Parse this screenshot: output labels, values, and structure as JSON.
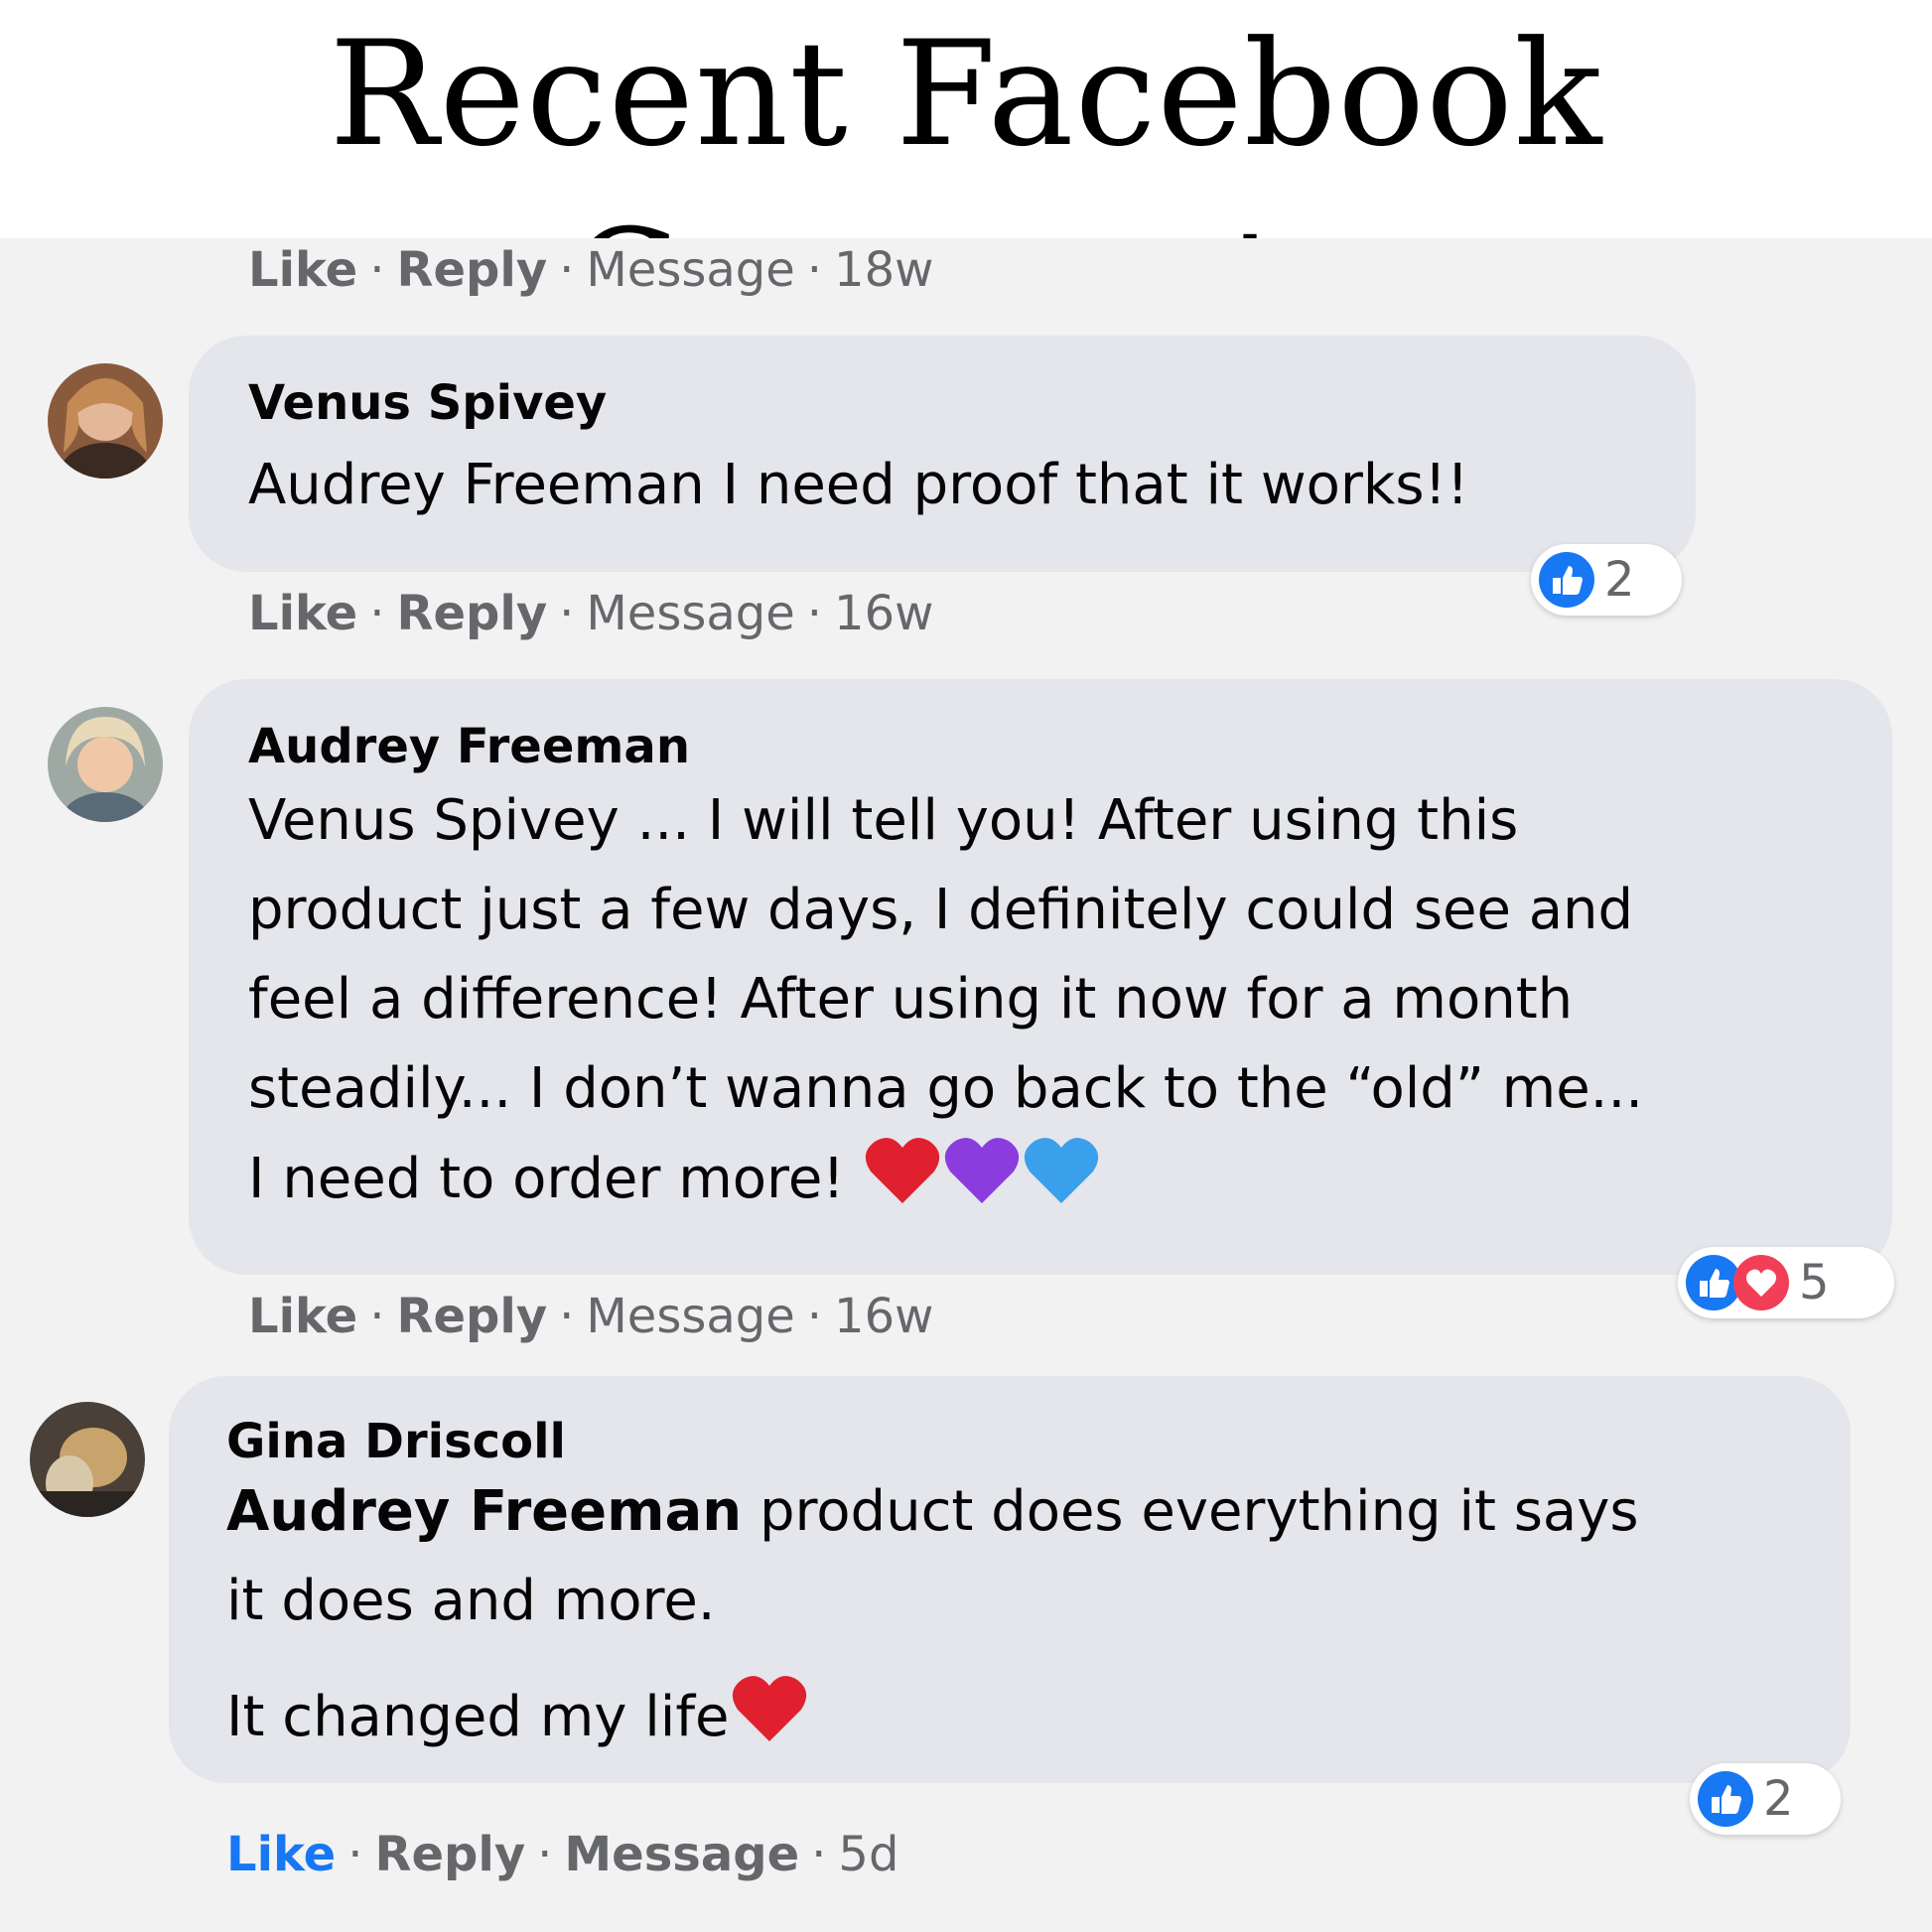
{
  "page": {
    "title": "Recent Facebook Comments"
  },
  "colors": {
    "like_blue": "#1877f2",
    "love_red": "#f33e58",
    "bubble_bg": "#e4e6eb",
    "feed_bg": "#f2f2f3",
    "meta_gray": "#65676b"
  },
  "top_actions": {
    "like": "Like",
    "reply": "Reply",
    "message": "Message",
    "time": "18w"
  },
  "comments": [
    {
      "author": "Venus Spivey",
      "avatar_icon": "profile-photo",
      "lines": [
        "Audrey Freeman I need proof that it works!!"
      ],
      "reactions": {
        "icons": [
          "like-icon"
        ],
        "count": "2"
      },
      "actions": {
        "like": "Like",
        "reply": "Reply",
        "message": "Message",
        "time": "16w"
      }
    },
    {
      "author": "Audrey Freeman",
      "avatar_icon": "profile-photo",
      "lines": [
        "Venus Spivey ... I will tell you! After using this",
        "product just a few days, I definitely could see and",
        "feel a difference! After using it now for a month",
        "steadily... I don’t wanna go back to the “old” me...",
        "I need to order more!"
      ],
      "emoji": [
        "red-heart-icon",
        "purple-heart-icon",
        "blue-heart-icon"
      ],
      "reactions": {
        "icons": [
          "like-icon",
          "love-icon"
        ],
        "count": "5"
      },
      "actions": {
        "like": "Like",
        "reply": "Reply",
        "message": "Message",
        "time": "16w"
      }
    },
    {
      "author": "Gina Driscoll",
      "avatar_icon": "profile-photo",
      "mention": "Audrey Freeman",
      "lines": [
        " product does everything it says",
        "it does and more.",
        "It changed my life"
      ],
      "emoji": [
        "red-heart-icon"
      ],
      "reactions": {
        "icons": [
          "like-icon"
        ],
        "count": "2"
      },
      "actions": {
        "like": "Like",
        "reply": "Reply",
        "message": "Message",
        "time": "5d"
      }
    }
  ]
}
